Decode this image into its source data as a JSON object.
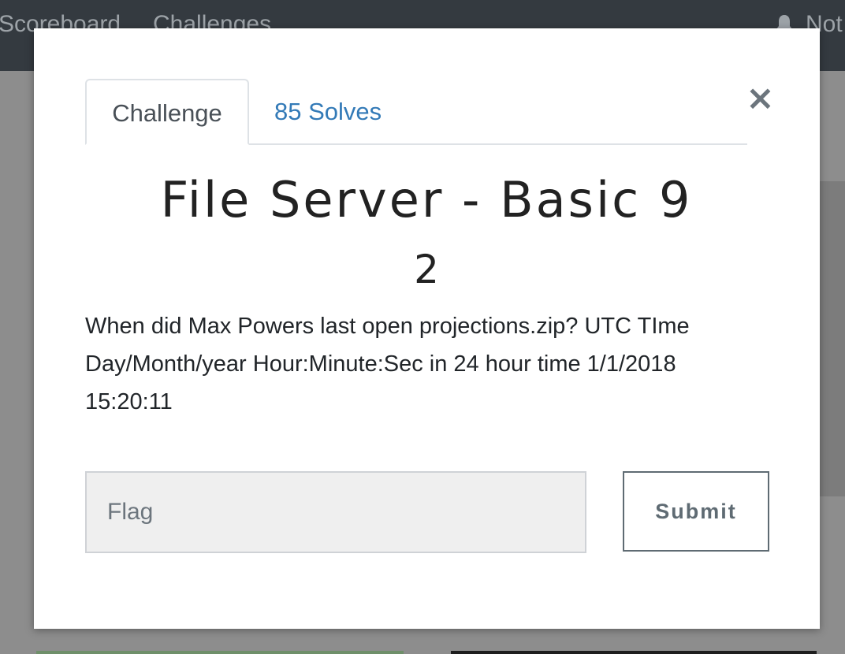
{
  "navbar": {
    "items": [
      "Scoreboard",
      "Challenges"
    ],
    "notifications_label": "Not"
  },
  "modal": {
    "close_symbol": "×",
    "tabs": [
      {
        "label": "Challenge",
        "active": true
      },
      {
        "label": "85 Solves",
        "active": false
      }
    ],
    "challenge": {
      "title": "File Server - Basic 9",
      "value": "2",
      "description": "When did Max Powers last open projections.zip? UTC TIme Day/Month/year Hour:Minute:Sec in 24 hour time 1/1/2018 15:20:11"
    },
    "flag_input": {
      "placeholder": "Flag",
      "value": ""
    },
    "submit_label": "Submit"
  },
  "colors": {
    "navbar_bg": "#343a40",
    "link_blue": "#337ab7",
    "overlay_bg": "#8a8a8a"
  },
  "icons": [
    "bell-icon",
    "close-icon"
  ]
}
